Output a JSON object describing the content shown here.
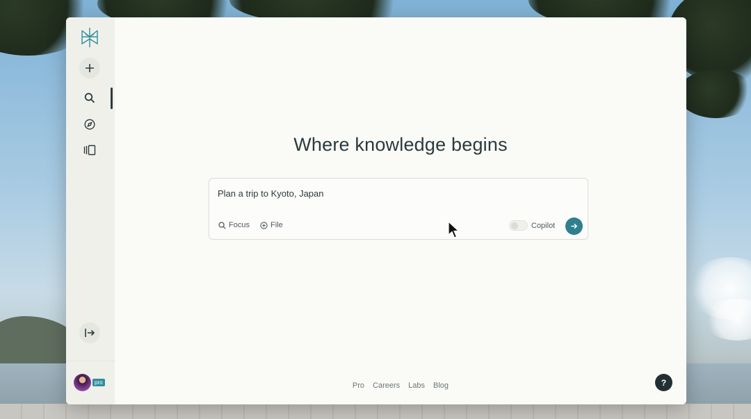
{
  "main": {
    "headline": "Where knowledge begins"
  },
  "search": {
    "query": "Plan a trip to Kyoto, Japan",
    "focus_label": "Focus",
    "file_label": "File",
    "copilot_label": "Copilot",
    "copilot_enabled": false
  },
  "sidebar": {
    "badge": "pro"
  },
  "footer": {
    "links": [
      "Pro",
      "Careers",
      "Labs",
      "Blog"
    ]
  },
  "help": {
    "label": "?"
  },
  "colors": {
    "accent": "#2f7f8f",
    "text_dark": "#2a3a3e",
    "help_bg": "#233033"
  }
}
